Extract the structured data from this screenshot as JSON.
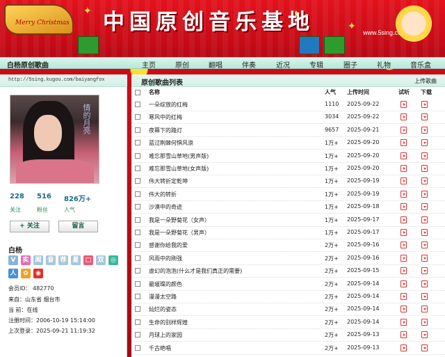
{
  "banner": {
    "title": "中国原创音乐基地",
    "site": "www.5sing.com",
    "sled_text": "Merry Christmas"
  },
  "nav": {
    "brand": "白杨原创歌曲",
    "items": [
      "主页",
      "原创",
      "翻唱",
      "伴奏",
      "近况",
      "专辑",
      "圈子",
      "礼物",
      "音乐盒"
    ]
  },
  "profile": {
    "url": "http://5sing.kugou.com/baiyangfox",
    "avatar_text": "情的月亮",
    "stats": [
      {
        "value": "228",
        "label": "关注"
      },
      {
        "value": "516",
        "label": "粉丝"
      },
      {
        "value": "826万+",
        "label": "人气"
      }
    ],
    "follow_label": "+ 关注",
    "message_label": "留言",
    "name": "白杨",
    "badges": [
      {
        "glyph": "V",
        "color": "#8ab4d8"
      },
      {
        "glyph": "实",
        "color": "#e36fb5"
      },
      {
        "glyph": "闻",
        "color": "#a6c6de"
      },
      {
        "glyph": "音",
        "color": "#a6c6de"
      },
      {
        "glyph": "荐",
        "color": "#a6c6de"
      },
      {
        "glyph": "星",
        "color": "#a6c6de"
      },
      {
        "glyph": "□",
        "color": "#e85a7a"
      },
      {
        "glyph": "双",
        "color": "#a6c6de"
      },
      {
        "glyph": "◎",
        "color": "#3cb89a"
      },
      {
        "glyph": "人",
        "color": "#4a90d9"
      },
      {
        "glyph": "✿",
        "color": "#f0a020"
      },
      {
        "glyph": "◉",
        "color": "#e0302a"
      }
    ],
    "info": [
      "会员ID： 482770",
      "来自：山东省 烟台市",
      "当    前：在线",
      "注册时间：2006-10-19 15:14:00",
      "上次登录：2025-09-21 11:19:32"
    ]
  },
  "songs": {
    "header_title": "原创歌曲列表",
    "upload_label": "上传歌曲",
    "columns": {
      "name": "名称",
      "plays": "人气",
      "date": "上传时间",
      "listen": "试听",
      "download": "下载"
    },
    "rows": [
      {
        "name": "一朵绽放的红梅",
        "plays": "1110",
        "date": "2025-09-22"
      },
      {
        "name": "寒风中的红梅",
        "plays": "3034",
        "date": "2025-09-22"
      },
      {
        "name": "夜幕下的路灯",
        "plays": "9657",
        "date": "2025-09-21"
      },
      {
        "name": "蓝过荆棘何惧风浪",
        "plays": "1万+",
        "date": "2025-09-20"
      },
      {
        "name": "难忘那雪山草地(男声版)",
        "plays": "1万+",
        "date": "2025-09-20"
      },
      {
        "name": "难忘那雪山草地(女声版)",
        "plays": "1万+",
        "date": "2025-09-20"
      },
      {
        "name": "伟大转折定乾坤",
        "plays": "1万+",
        "date": "2025-09-19"
      },
      {
        "name": "伟大的转折",
        "plays": "1万+",
        "date": "2025-09-19"
      },
      {
        "name": "沙漠中的奇迹",
        "plays": "1万+",
        "date": "2025-09-18"
      },
      {
        "name": "我是一朵野菊花（女声）",
        "plays": "1万+",
        "date": "2025-09-17"
      },
      {
        "name": "我是一朵野菊花（男声）",
        "plays": "1万+",
        "date": "2025-09-17"
      },
      {
        "name": "感谢你给我的爱",
        "plays": "2万+",
        "date": "2025-09-16"
      },
      {
        "name": "风雨中的刚强",
        "plays": "2万+",
        "date": "2025-09-16"
      },
      {
        "name": "虚幻的泡泡(什么才是我们真正的需要)",
        "plays": "2万+",
        "date": "2025-09-15"
      },
      {
        "name": "最璀璨的颜色",
        "plays": "2万+",
        "date": "2025-09-14"
      },
      {
        "name": "漫漫太空路",
        "plays": "2万+",
        "date": "2025-09-14"
      },
      {
        "name": "灿烂的姿态",
        "plays": "2万+",
        "date": "2025-09-14"
      },
      {
        "name": "生命的别样辉煌",
        "plays": "2万+",
        "date": "2025-09-14"
      },
      {
        "name": "月球上的家园",
        "plays": "2万+",
        "date": "2025-09-13"
      },
      {
        "name": "千古绝唱",
        "plays": "2万+",
        "date": "2025-09-13"
      }
    ]
  }
}
